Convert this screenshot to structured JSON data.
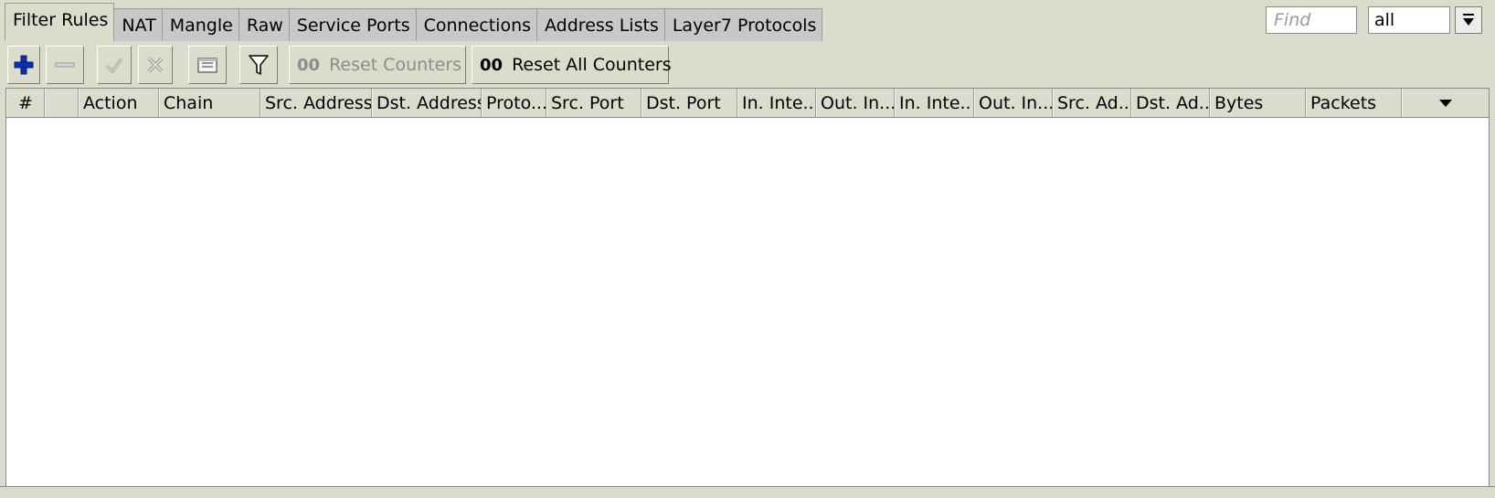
{
  "tabs": [
    {
      "label": "Filter Rules",
      "active": true
    },
    {
      "label": "NAT",
      "active": false
    },
    {
      "label": "Mangle",
      "active": false
    },
    {
      "label": "Raw",
      "active": false
    },
    {
      "label": "Service Ports",
      "active": false
    },
    {
      "label": "Connections",
      "active": false
    },
    {
      "label": "Address Lists",
      "active": false
    },
    {
      "label": "Layer7 Protocols",
      "active": false
    }
  ],
  "toolbar": {
    "add_icon": "plus-icon",
    "remove_icon": "minus-icon",
    "enable_icon": "check-icon",
    "disable_icon": "cross-icon",
    "comment_icon": "note-icon",
    "filter_icon": "funnel-icon",
    "counter_glyph": "00",
    "reset_counters": "Reset Counters",
    "reset_all_counters": "Reset All Counters",
    "find_placeholder": "Find",
    "filter_select_value": "all"
  },
  "table": {
    "columns": [
      "#",
      "",
      "Action",
      "Chain",
      "Src. Address",
      "Dst. Address",
      "Proto...",
      "Src. Port",
      "Dst. Port",
      "In. Inte..",
      "Out. In...",
      "In. Inte..",
      "Out. In...",
      "Src. Ad...",
      "Dst. Ad...",
      "Bytes",
      "Packets"
    ],
    "rows": []
  },
  "colors": {
    "background": "#dcdccc",
    "accent_blue": "#0b2fb3"
  }
}
